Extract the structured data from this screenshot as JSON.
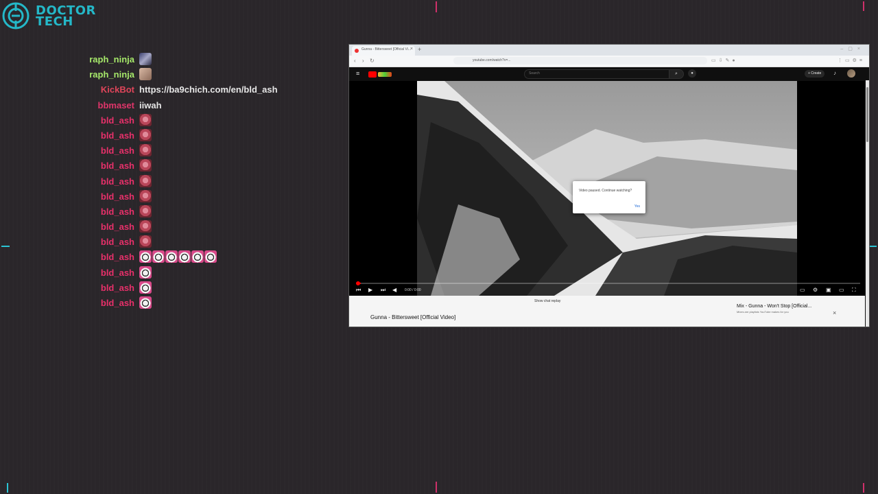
{
  "logo": {
    "line1": "DOCTOR",
    "line2": "TECH"
  },
  "chat": [
    {
      "user": "raph_ninja",
      "color": "#a6e86a",
      "text": "",
      "emotes": [
        "avatar1"
      ]
    },
    {
      "user": "raph_ninja",
      "color": "#a6e86a",
      "text": "",
      "emotes": [
        "avatar2"
      ]
    },
    {
      "user": "KickBot",
      "color": "#e0455a",
      "text": "https://ba9chich.com/en/bld_ash",
      "emotes": []
    },
    {
      "user": "bbmaset",
      "color": "#e0356a",
      "text": "iiwah",
      "emotes": []
    },
    {
      "user": "bld_ash",
      "color": "#e8306a",
      "text": "",
      "emotes": [
        "bag"
      ]
    },
    {
      "user": "bld_ash",
      "color": "#e8306a",
      "text": "",
      "emotes": [
        "bag"
      ]
    },
    {
      "user": "bld_ash",
      "color": "#e8306a",
      "text": "",
      "emotes": [
        "bag"
      ]
    },
    {
      "user": "bld_ash",
      "color": "#e8306a",
      "text": "",
      "emotes": [
        "bag"
      ]
    },
    {
      "user": "bld_ash",
      "color": "#e8306a",
      "text": "",
      "emotes": [
        "bag"
      ]
    },
    {
      "user": "bld_ash",
      "color": "#e8306a",
      "text": "",
      "emotes": [
        "bag"
      ]
    },
    {
      "user": "bld_ash",
      "color": "#e8306a",
      "text": "",
      "emotes": [
        "bag"
      ]
    },
    {
      "user": "bld_ash",
      "color": "#e8306a",
      "text": "",
      "emotes": [
        "bag"
      ]
    },
    {
      "user": "bld_ash",
      "color": "#e8306a",
      "text": "",
      "emotes": [
        "bag"
      ]
    },
    {
      "user": "bld_ash",
      "color": "#e8306a",
      "text": "",
      "emotes": [
        "face",
        "face",
        "face",
        "face",
        "face",
        "face"
      ]
    },
    {
      "user": "bld_ash",
      "color": "#e8306a",
      "text": "",
      "emotes": [
        "face"
      ]
    },
    {
      "user": "bld_ash",
      "color": "#e8306a",
      "text": "",
      "emotes": [
        "face"
      ]
    },
    {
      "user": "bld_ash",
      "color": "#e8306a",
      "text": "",
      "emotes": [
        "face"
      ]
    }
  ],
  "browser": {
    "tab_title": "Gunna - Bittersweet [Official Vi...",
    "url": "youtube.com/watch?v=...",
    "youtube": {
      "search_placeholder": "Search",
      "create_label": "+ Create",
      "dialog_text": "Video paused. Continue watching?",
      "dialog_yes": "Yes",
      "time": "0:00 / 0:00",
      "progress": 0.01,
      "show_chat": "Show chat replay",
      "video_title": "Gunna - Bittersweet [Official Video]",
      "mix_title": "Mix - Gunna - Won't Stop [Official...",
      "mix_sub": "Mixes are playlists YouTube makes for you"
    }
  },
  "colors": {
    "accent": "#24b8c8",
    "marker": "#d0306a"
  }
}
